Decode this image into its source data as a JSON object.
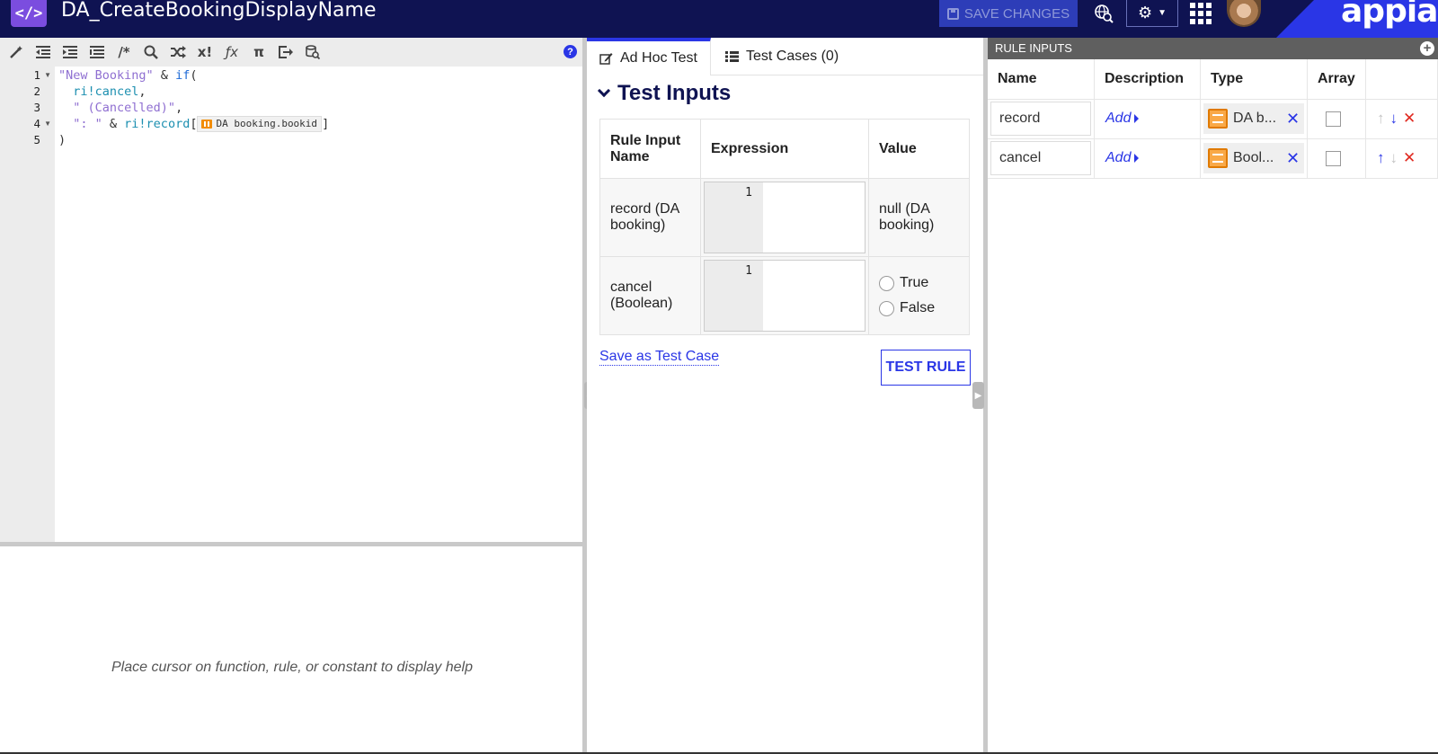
{
  "header": {
    "app_icon": "</>",
    "title": "DA_CreateBookingDisplayName",
    "save_label": "SAVE CHANGES",
    "brand": "appian",
    "icons": [
      "code-icon",
      "save-icon",
      "globe-search-icon",
      "gear-icon",
      "app-grid-icon",
      "avatar"
    ]
  },
  "toolbar": {
    "icons": [
      "magic-wand-icon",
      "outdent-icon",
      "indent-icon",
      "format-icon",
      "comment-icon",
      "search-icon",
      "shuffle-icon",
      "rule-icon",
      "function-icon",
      "pi-icon",
      "export-icon",
      "query-icon",
      "help-icon"
    ],
    "labels": [
      "/*",
      "x!",
      "ƒx",
      "π"
    ],
    "help": "?"
  },
  "editor": {
    "lines": [
      {
        "num": "1",
        "fold": true,
        "tokens": [
          {
            "cls": "s",
            "t": "\"New Booking\""
          },
          {
            "cls": "op",
            "t": " & "
          },
          {
            "cls": "k",
            "t": "if"
          },
          {
            "cls": "op",
            "t": "("
          }
        ]
      },
      {
        "num": "2",
        "fold": false,
        "tokens": [
          {
            "cls": "op",
            "t": "  "
          },
          {
            "cls": "ri",
            "t": "ri!cancel"
          },
          {
            "cls": "op",
            "t": ","
          }
        ]
      },
      {
        "num": "3",
        "fold": false,
        "tokens": [
          {
            "cls": "op",
            "t": "  "
          },
          {
            "cls": "s",
            "t": "\" (Cancelled)\""
          },
          {
            "cls": "op",
            "t": ","
          }
        ]
      },
      {
        "num": "4",
        "fold": true,
        "tokens": [
          {
            "cls": "op",
            "t": "  "
          },
          {
            "cls": "s",
            "t": "\": \""
          },
          {
            "cls": "op",
            "t": " & "
          },
          {
            "cls": "ri",
            "t": "ri!record"
          },
          {
            "cls": "op",
            "t": "["
          },
          {
            "cls": "chip",
            "t": "DA booking.bookid"
          },
          {
            "cls": "op",
            "t": "]"
          }
        ]
      },
      {
        "num": "5",
        "fold": false,
        "tokens": [
          {
            "cls": "op",
            "t": ")"
          }
        ]
      }
    ],
    "help_text": "Place cursor on function, rule, or constant to display help"
  },
  "tabs": {
    "adhoc": "Ad Hoc Test",
    "cases": "Test Cases (0)"
  },
  "test_inputs": {
    "title": "Test Inputs",
    "columns": [
      "Rule Input Name",
      "Expression",
      "Value"
    ],
    "rows": [
      {
        "name": "record (DA booking)",
        "expr_line": "1",
        "value": "null (DA booking)"
      },
      {
        "name": "cancel (Boolean)",
        "expr_line": "1",
        "radio_true": "True",
        "radio_false": "False"
      }
    ],
    "save_link": "Save as Test Case",
    "test_button": "TEST RULE"
  },
  "rule_inputs": {
    "header": "RULE INPUTS",
    "add": "+",
    "columns": [
      "Name",
      "Description",
      "Type",
      "Array"
    ],
    "rows": [
      {
        "name": "record",
        "desc": "Add",
        "type": "DA b...",
        "array": false,
        "up_enabled": false,
        "down_enabled": true
      },
      {
        "name": "cancel",
        "desc": "Add",
        "type": "Bool...",
        "array": false,
        "up_enabled": true,
        "down_enabled": false
      }
    ],
    "remove": "✕",
    "up": "↑",
    "down": "↓",
    "delete": "✕"
  },
  "colors": {
    "header_bg": "#0f1352",
    "accent": "#2a36e6",
    "app_icon": "#7b4ddf",
    "type_icon": "#f28c00",
    "delete": "#e0281f"
  }
}
